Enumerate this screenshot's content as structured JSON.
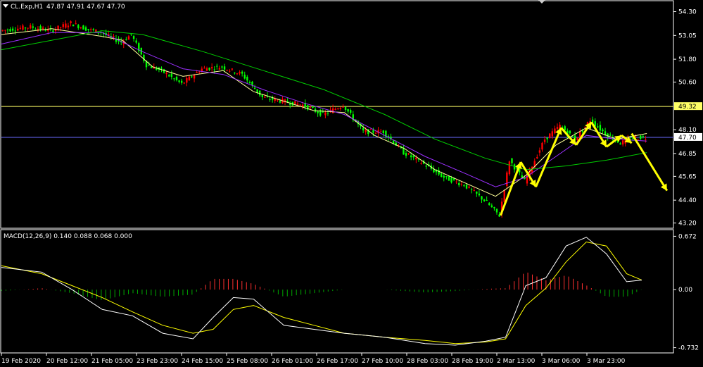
{
  "header": {
    "symbol": "CL.Exp,H1",
    "ohlc": "47.87 47.91 47.67 47.70"
  },
  "macd_header": "MACD(12,26,9) 0.140 0.088 0.068 0.000",
  "colors": {
    "background": "#000000",
    "axis": "#ffffff",
    "bull_candle": "#ff0000",
    "bear_candle": "#00ff00",
    "ma_fast": "#ffff99",
    "ma_mid": "#9b30ff",
    "ma_slow": "#00cc00",
    "hline_resistance": "#ffff66",
    "hline_bid": "#6a6aff",
    "arrows": "#ffff00",
    "macd_line": "#ffffff",
    "signal_line": "#ffff00",
    "hist_pos": "#ff3030",
    "hist_neg": "#00aa00"
  },
  "price_axis": {
    "ticks": [
      "54.30",
      "53.05",
      "51.80",
      "50.60",
      "48.10",
      "46.85",
      "45.65",
      "44.40",
      "43.20"
    ],
    "marks": [
      {
        "label": "49.32",
        "kind": "resistance"
      },
      {
        "label": "47.70",
        "kind": "bid"
      }
    ]
  },
  "macd_axis": {
    "ticks": [
      "0.672",
      "0.00",
      "-0.732"
    ]
  },
  "time_axis": {
    "labels": [
      "19 Feb 2020",
      "20 Feb 12:00",
      "21 Feb 05:00",
      "23 Feb 23:00",
      "24 Feb 15:00",
      "25 Feb 08:00",
      "26 Feb 01:00",
      "26 Feb 17:00",
      "27 Feb 10:00",
      "28 Feb 03:00",
      "28 Feb 19:00",
      "2 Mar 13:00",
      "3 Mar 06:00",
      "3 Mar 23:00"
    ]
  },
  "chart_data": {
    "type": "candlestick",
    "title": "CL.Exp,H1",
    "y_range": [
      43.0,
      54.8
    ],
    "x_labels": [
      "19 Feb 2020",
      "20 Feb 12:00",
      "21 Feb 05:00",
      "23 Feb 23:00",
      "24 Feb 15:00",
      "25 Feb 08:00",
      "26 Feb 01:00",
      "26 Feb 17:00",
      "27 Feb 10:00",
      "28 Feb 03:00",
      "28 Feb 19:00",
      "2 Mar 13:00",
      "3 Mar 06:00",
      "3 Mar 23:00"
    ],
    "price_path": [
      [
        0,
        53.3
      ],
      [
        6,
        53.5
      ],
      [
        10,
        53.3
      ],
      [
        14,
        53.7
      ],
      [
        17,
        53.4
      ],
      [
        20,
        53.2
      ],
      [
        24,
        52.7
      ],
      [
        26,
        53.1
      ],
      [
        29,
        51.5
      ],
      [
        32,
        51.2
      ],
      [
        36,
        50.5
      ],
      [
        40,
        51.3
      ],
      [
        44,
        51.4
      ],
      [
        48,
        51.0
      ],
      [
        52,
        49.8
      ],
      [
        56,
        49.6
      ],
      [
        60,
        49.4
      ],
      [
        64,
        48.9
      ],
      [
        68,
        49.4
      ],
      [
        72,
        48.0
      ],
      [
        76,
        48.0
      ],
      [
        80,
        46.9
      ],
      [
        84,
        46.3
      ],
      [
        88,
        45.6
      ],
      [
        92,
        45.2
      ],
      [
        96,
        44.4
      ],
      [
        99,
        43.6
      ],
      [
        101,
        46.5
      ],
      [
        104,
        45.4
      ],
      [
        108,
        47.6
      ],
      [
        111,
        48.3
      ],
      [
        114,
        47.6
      ],
      [
        117,
        48.6
      ],
      [
        120,
        47.9
      ],
      [
        123,
        47.4
      ],
      [
        126,
        47.7
      ],
      [
        128,
        47.7
      ]
    ],
    "moving_averages": [
      {
        "name": "fast",
        "points": [
          [
            0,
            53.1
          ],
          [
            10,
            53.4
          ],
          [
            20,
            53.0
          ],
          [
            24,
            52.8
          ],
          [
            30,
            51.4
          ],
          [
            36,
            50.9
          ],
          [
            44,
            51.2
          ],
          [
            50,
            50.1
          ],
          [
            56,
            49.6
          ],
          [
            62,
            49.1
          ],
          [
            68,
            49.0
          ],
          [
            74,
            47.8
          ],
          [
            80,
            47.1
          ],
          [
            86,
            46.0
          ],
          [
            92,
            45.3
          ],
          [
            98,
            44.6
          ],
          [
            104,
            45.7
          ],
          [
            110,
            47.3
          ],
          [
            116,
            48.2
          ],
          [
            122,
            47.6
          ],
          [
            128,
            47.9
          ]
        ]
      },
      {
        "name": "mid",
        "points": [
          [
            0,
            52.6
          ],
          [
            10,
            53.2
          ],
          [
            20,
            53.2
          ],
          [
            28,
            52.2
          ],
          [
            36,
            51.3
          ],
          [
            44,
            51.0
          ],
          [
            52,
            50.2
          ],
          [
            60,
            49.5
          ],
          [
            68,
            48.9
          ],
          [
            76,
            47.8
          ],
          [
            84,
            46.7
          ],
          [
            92,
            45.8
          ],
          [
            98,
            45.1
          ],
          [
            104,
            45.6
          ],
          [
            110,
            46.7
          ],
          [
            116,
            47.8
          ],
          [
            122,
            47.6
          ],
          [
            128,
            47.5
          ]
        ]
      },
      {
        "name": "slow",
        "points": [
          [
            0,
            52.3
          ],
          [
            10,
            52.8
          ],
          [
            20,
            53.3
          ],
          [
            28,
            53.1
          ],
          [
            40,
            52.2
          ],
          [
            52,
            51.2
          ],
          [
            64,
            50.2
          ],
          [
            76,
            48.9
          ],
          [
            86,
            47.6
          ],
          [
            96,
            46.6
          ],
          [
            104,
            46.0
          ],
          [
            112,
            46.2
          ],
          [
            120,
            46.5
          ],
          [
            128,
            46.9
          ]
        ]
      }
    ],
    "horizontal_lines": [
      49.32,
      47.7
    ],
    "annotations": "yellow zigzag arrows indicating projected move down",
    "zigzag": [
      [
        99,
        43.6
      ],
      [
        103,
        46.4
      ],
      [
        106,
        45.1
      ],
      [
        111,
        48.2
      ],
      [
        114,
        47.3
      ],
      [
        117,
        48.5
      ],
      [
        120,
        47.2
      ],
      [
        123,
        47.8
      ],
      [
        125,
        47.4
      ]
    ],
    "projection": [
      [
        125,
        47.9
      ],
      [
        132,
        44.9
      ]
    ],
    "macd": {
      "params": "12,26,9",
      "values": "0.140 0.088 0.068 0.000",
      "y_range": [
        -0.78,
        0.72
      ],
      "macd_line": [
        [
          0,
          0.28
        ],
        [
          8,
          0.22
        ],
        [
          14,
          0.0
        ],
        [
          20,
          -0.25
        ],
        [
          26,
          -0.33
        ],
        [
          32,
          -0.55
        ],
        [
          38,
          -0.62
        ],
        [
          42,
          -0.35
        ],
        [
          46,
          -0.1
        ],
        [
          50,
          -0.12
        ],
        [
          56,
          -0.45
        ],
        [
          62,
          -0.5
        ],
        [
          68,
          -0.55
        ],
        [
          76,
          -0.6
        ],
        [
          84,
          -0.68
        ],
        [
          90,
          -0.7
        ],
        [
          96,
          -0.65
        ],
        [
          100,
          -0.6
        ],
        [
          104,
          0.05
        ],
        [
          108,
          0.15
        ],
        [
          112,
          0.55
        ],
        [
          116,
          0.66
        ],
        [
          120,
          0.45
        ],
        [
          124,
          0.1
        ],
        [
          127,
          0.12
        ]
      ],
      "signal_line": [
        [
          0,
          0.3
        ],
        [
          8,
          0.2
        ],
        [
          14,
          0.05
        ],
        [
          20,
          -0.1
        ],
        [
          26,
          -0.28
        ],
        [
          32,
          -0.45
        ],
        [
          38,
          -0.55
        ],
        [
          42,
          -0.5
        ],
        [
          46,
          -0.25
        ],
        [
          50,
          -0.2
        ],
        [
          56,
          -0.35
        ],
        [
          62,
          -0.45
        ],
        [
          68,
          -0.55
        ],
        [
          76,
          -0.6
        ],
        [
          84,
          -0.64
        ],
        [
          90,
          -0.68
        ],
        [
          96,
          -0.66
        ],
        [
          100,
          -0.62
        ],
        [
          104,
          -0.2
        ],
        [
          108,
          0.02
        ],
        [
          112,
          0.35
        ],
        [
          116,
          0.6
        ],
        [
          120,
          0.55
        ],
        [
          124,
          0.2
        ],
        [
          127,
          0.12
        ]
      ]
    }
  }
}
